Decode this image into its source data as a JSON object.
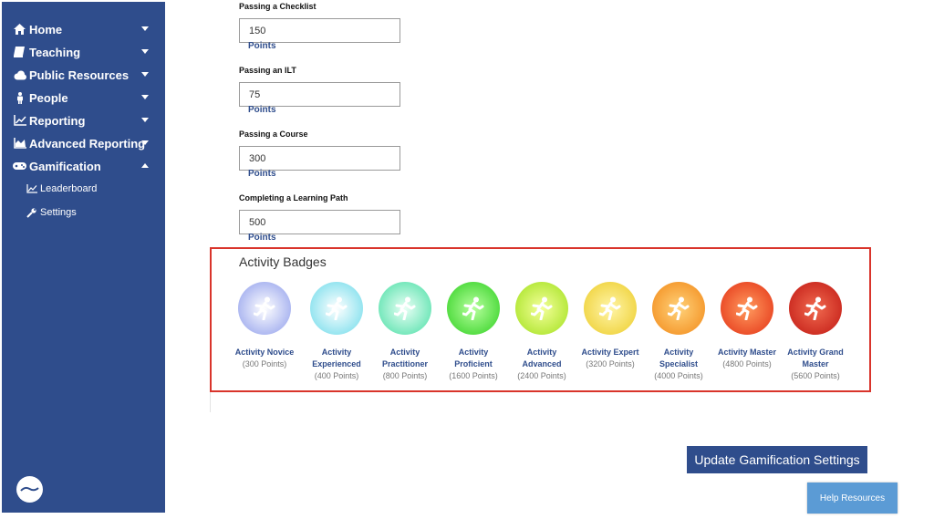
{
  "sidebar": {
    "items": [
      {
        "label": "Home",
        "icon": "home-icon"
      },
      {
        "label": "Teaching",
        "icon": "book-icon"
      },
      {
        "label": "Public Resources",
        "icon": "cloud-icon"
      },
      {
        "label": "People",
        "icon": "person-icon"
      },
      {
        "label": "Reporting",
        "icon": "line-chart-icon"
      },
      {
        "label": "Advanced Reporting",
        "icon": "area-chart-icon"
      },
      {
        "label": "Gamification",
        "icon": "gamepad-icon"
      }
    ],
    "sub_items": [
      {
        "label": "Leaderboard",
        "icon": "line-chart-icon"
      },
      {
        "label": "Settings",
        "icon": "wrench-icon"
      }
    ]
  },
  "fields": [
    {
      "label": "Passing a Checklist",
      "value": "150",
      "unit": "Points"
    },
    {
      "label": "Passing an ILT",
      "value": "75",
      "unit": "Points"
    },
    {
      "label": "Passing a Course",
      "value": "300",
      "unit": "Points"
    },
    {
      "label": "Completing a Learning Path",
      "value": "500",
      "unit": "Points"
    }
  ],
  "badges": {
    "title": "Activity Badges",
    "items": [
      {
        "name": "Activity Novice",
        "points": "(300 Points)",
        "color": "#a9b4f0"
      },
      {
        "name": "Activity Experienced",
        "points": "(400 Points)",
        "color": "#8fe3ef"
      },
      {
        "name": "Activity Practitioner",
        "points": "(800 Points)",
        "color": "#6fe6b8"
      },
      {
        "name": "Activity Proficient",
        "points": "(1600 Points)",
        "color": "#4fdb3e"
      },
      {
        "name": "Activity Advanced",
        "points": "(2400 Points)",
        "color": "#b5e83a"
      },
      {
        "name": "Activity Expert",
        "points": "(3200 Points)",
        "color": "#f1d648"
      },
      {
        "name": "Activity Specialist",
        "points": "(4000 Points)",
        "color": "#f59a2f"
      },
      {
        "name": "Activity Master",
        "points": "(4800 Points)",
        "color": "#ea4a26"
      },
      {
        "name": "Activity Grand Master",
        "points": "(5600 Points)",
        "color": "#cc2b21"
      }
    ]
  },
  "buttons": {
    "update": "Update Gamification Settings",
    "help": "Help Resources"
  }
}
